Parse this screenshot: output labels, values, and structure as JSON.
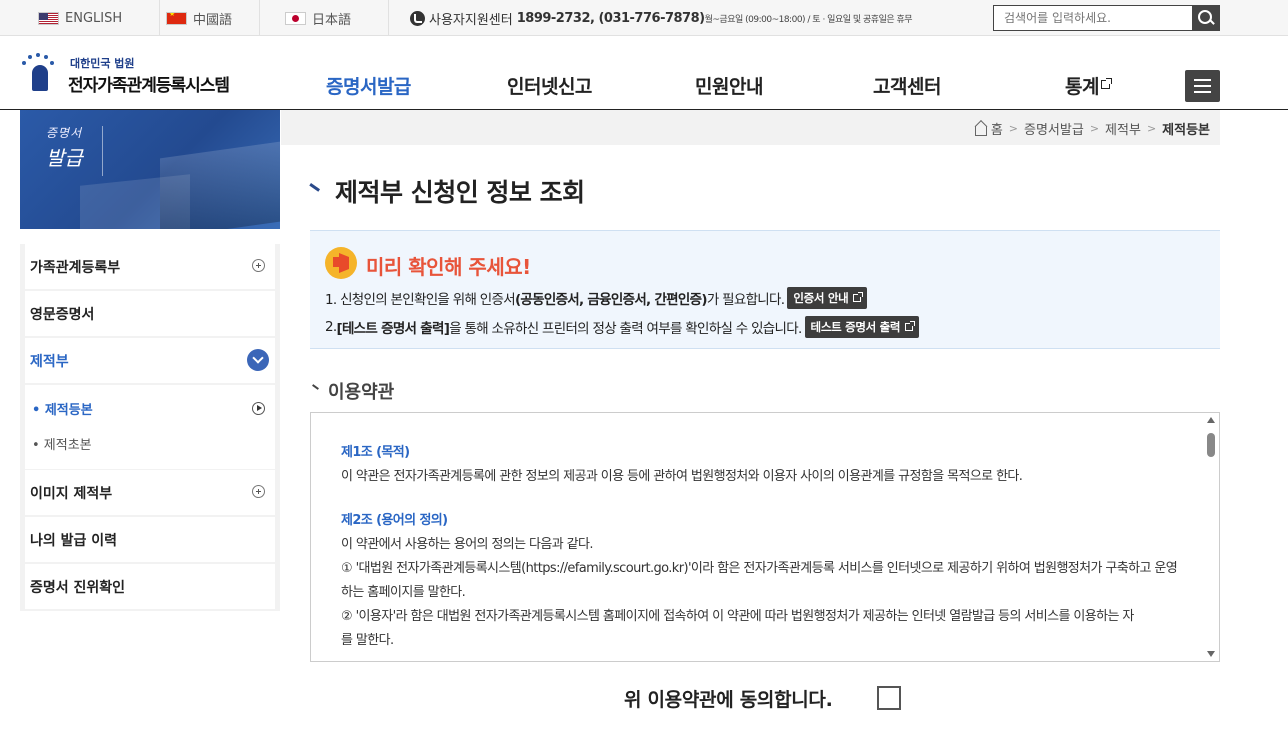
{
  "topbar": {
    "languages": [
      "ENGLISH",
      "中國語",
      "日本語"
    ],
    "support_label": "사용자지원센터",
    "support_phone": "1899-2732, (031-776-7878)",
    "support_hours": "월~금요일 (09:00~18:00) / 토 · 일요일 및 공휴일은 휴무",
    "search_placeholder": "검색어를 입력하세요."
  },
  "header": {
    "logo_sub": "대한민국 법원",
    "logo_main": "전자가족관계등록시스템",
    "nav": [
      "증명서발급",
      "인터넷신고",
      "민원안내",
      "고객센터",
      "통계"
    ]
  },
  "banner": {
    "line1": "증명서",
    "line2": "발급"
  },
  "sidebar": {
    "items": [
      "가족관계등록부",
      "영문증명서",
      "제적부",
      "이미지 제적부",
      "나의 발급 이력",
      "증명서 진위확인"
    ],
    "sub_items": [
      "• 제적등본",
      "• 제적초본"
    ]
  },
  "breadcrumb": [
    "홈",
    "증명서발급",
    "제적부",
    "제적등본"
  ],
  "page_title": "제적부 신청인 정보 조회",
  "notice": {
    "title": "미리 확인해 주세요!",
    "line1_pre": "1. 신청인의 본인확인을 위해 인증서",
    "line1_bold": "(공동인증서, 금융인증서, 간편인증)",
    "line1_post": "가 필요합니다.",
    "line1_button": "인증서 안내",
    "line2_pre": "2. ",
    "line2_bold": "[테스트 증명서 출력]",
    "line2_post": "을 통해 소유하신 프린터의 정상 출력 여부를 확인하실 수 있습니다.",
    "line2_button": "테스트 증명서 출력"
  },
  "terms": {
    "section_title": "이용약관",
    "art1_title": "제1조 (목적)",
    "art1_text": "이 약관은 전자가족관계등록에 관한 정보의 제공과 이용 등에 관하여 법원행정처와 이용자 사이의 이용관계를 규정함을 목적으로 한다.",
    "art2_title": "제2조 (용어의 정의)",
    "art2_intro": "이 약관에서 사용하는 용어의 정의는 다음과 같다.",
    "art2_item1a": "① '대법원 전자가족관계등록시스템(https://efamily.scourt.go.kr)'이라 함은 전자가족관계등록 서비스를 인터넷으로 제공하기 위하여 법원행정처가 구축하고 운영",
    "art2_item1b": "하는 홈페이지를 말한다.",
    "art2_item2a": "② '이용자'라 함은 대법원 전자가족관계등록시스템 홈페이지에 접속하여 이 약관에 따라 법원행정처가 제공하는 인터넷 열람발급 등의 서비스를 이용하는 자",
    "art2_item2b": "를 말한다."
  },
  "agree_label": "위 이용약관에 동의합니다."
}
